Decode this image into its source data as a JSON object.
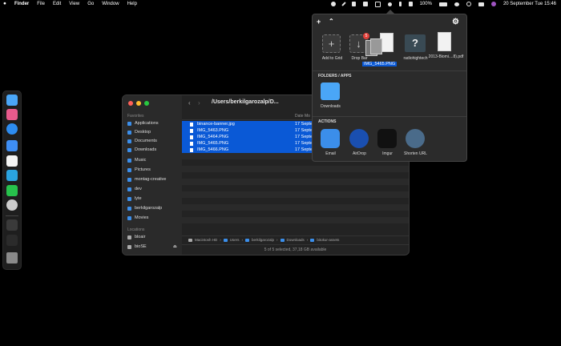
{
  "menubar": {
    "app": "Finder",
    "items": [
      "File",
      "Edit",
      "View",
      "Go",
      "Window",
      "Help"
    ],
    "battery": "100%",
    "datetime": "20 September Tue  15:46",
    "icons": [
      "control-icon",
      "quill-icon",
      "pause-icon",
      "save-icon",
      "dropover-icon",
      "brightness-icon",
      "bluetooth-icon",
      "volume-icon",
      "battery-icon",
      "wifi-icon",
      "search-icon",
      "control-center-icon",
      "siri-icon"
    ]
  },
  "finder": {
    "path_title": "/Users/berkilgarozalp/D...",
    "col_date": "Date Mo",
    "sidebar": {
      "favorites_label": "Favorites",
      "locations_label": "Locations",
      "favorites": [
        "Applications",
        "Desktop",
        "Documents",
        "Downloads",
        "Music",
        "Pictures",
        "montag-creative",
        "dev",
        "lyte",
        "berkilgarozalp",
        "Movies"
      ],
      "locations": [
        "bloair",
        "bioSE"
      ]
    },
    "files": [
      {
        "name": "binance-banner.jpg",
        "date": "17 Septe"
      },
      {
        "name": "IMG_5463.PNG",
        "date": "17 Septe"
      },
      {
        "name": "IMG_5464.PNG",
        "date": "17 Septe"
      },
      {
        "name": "IMG_5465.PNG",
        "date": "17 Septe"
      },
      {
        "name": "IMG_5466.PNG",
        "date": "17 Septe"
      }
    ],
    "pathbar": [
      "Macintosh HD",
      "Users",
      "berkilgarozalp",
      "Downloads",
      "bitokur-assets"
    ],
    "status": "5 of 5 selected, 37,18 GB available"
  },
  "popup": {
    "add_label": "Add to Grid",
    "drop_label": "Drop Bar",
    "drop_badge": "5",
    "drag_file": "IMG_5465.PNG",
    "shelf": [
      {
        "name": "radiohightech"
      },
      {
        "name": "2013-Biomi....8).pdf"
      }
    ],
    "folders_title": "FOLDERS / APPS",
    "folder": "Downloads",
    "actions_title": "ACTIONS",
    "actions": [
      {
        "name": "Email",
        "color": "#3b8eea"
      },
      {
        "name": "AirDrop",
        "color": "#1a4fb0"
      },
      {
        "name": "Imgur",
        "color": "#111111"
      },
      {
        "name": "Shorten URL",
        "color": "#4a6b8a"
      }
    ]
  }
}
